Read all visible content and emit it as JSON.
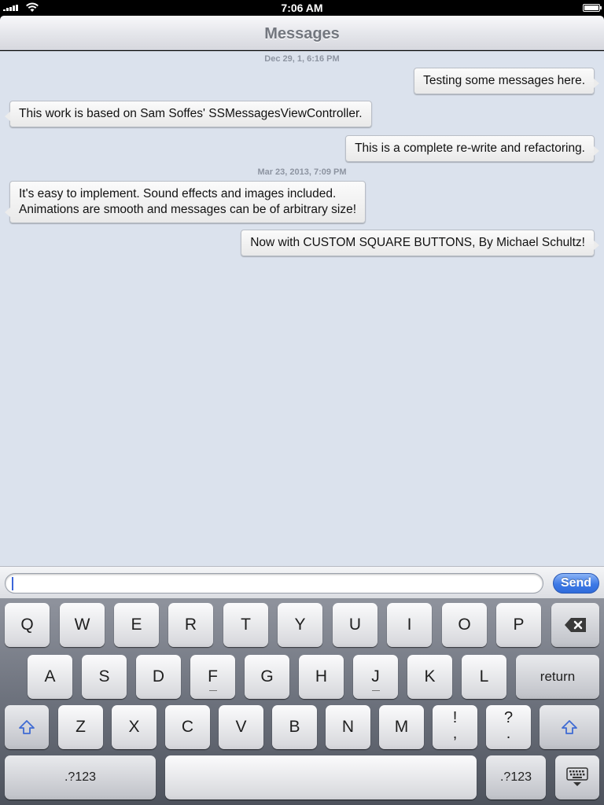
{
  "status_bar": {
    "time": "7:06 AM"
  },
  "nav": {
    "title": "Messages"
  },
  "conversation": {
    "timestamps": [
      "Dec 29, 1, 6:16 PM",
      "Mar 23, 2013, 7:09 PM"
    ],
    "messages": [
      {
        "direction": "outgoing",
        "text": "Testing some messages here."
      },
      {
        "direction": "incoming",
        "text": "This work is based on Sam Soffes' SSMessagesViewController."
      },
      {
        "direction": "outgoing",
        "text": "This is a complete re-write and refactoring."
      },
      {
        "direction": "incoming",
        "line1": "It's easy to implement. Sound effects and images included.",
        "line2": "Animations are smooth and messages can be of arbitrary size!"
      },
      {
        "direction": "outgoing",
        "text": "Now with CUSTOM SQUARE BUTTONS, By Michael Schultz!"
      }
    ]
  },
  "composer": {
    "value": "",
    "send_label": "Send"
  },
  "keyboard": {
    "row1": [
      "Q",
      "W",
      "E",
      "R",
      "T",
      "Y",
      "U",
      "I",
      "O",
      "P"
    ],
    "row2": [
      "A",
      "S",
      "D",
      "F",
      "G",
      "H",
      "J",
      "K",
      "L"
    ],
    "return_label": "return",
    "row3": [
      "Z",
      "X",
      "C",
      "V",
      "B",
      "N",
      "M"
    ],
    "punct1_top": "!",
    "punct1_bottom": ",",
    "punct2_top": "?",
    "punct2_bottom": ".",
    "numbers_label": ".?123",
    "icons": {
      "backspace": "backspace-icon",
      "shift": "shift-icon",
      "dismiss": "keyboard-dismiss-icon"
    }
  },
  "colors": {
    "background": "#dbe2ed",
    "send": "#3e7ae6",
    "caret": "#3c66d9",
    "nav_title": "#73777f"
  }
}
